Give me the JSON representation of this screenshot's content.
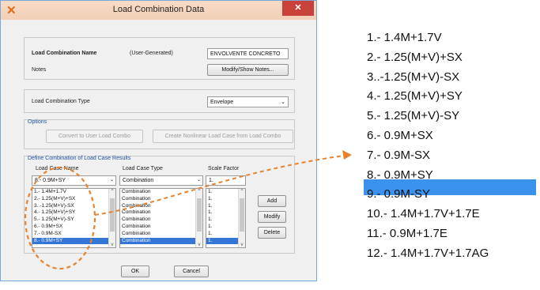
{
  "dialog": {
    "title": "Load Combination Data",
    "close_label": "✕",
    "combo_name_label": "Load Combination Name",
    "user_generated": "(User-Generated)",
    "combo_name_value": "ENVOLVENTE CONCRETO",
    "notes_label": "Notes",
    "modify_notes_button": "Modify/Show Notes...",
    "combo_type_label": "Load Combination Type",
    "combo_type_value": "Envelope",
    "options_label": "Options",
    "convert_button": "Convert to User Load Combo",
    "nonlinear_button": "Create Nonlinear Load Case from Load Combo",
    "define_label": "Define Combination of Load Case Results",
    "col_case_name": "Load Case Name",
    "col_case_type": "Load Case Type",
    "col_scale_factor": "Scale Factor",
    "case_name_input": "8.- 0.9M+SY",
    "case_type_input": "Combination",
    "scale_factor_input": "1.",
    "case_names": [
      "1.- 1.4M+1.7V",
      "2.- 1.25(M+V)+SX",
      "3..-1.25(M+V)-SX",
      "4.- 1.25(M+V)+SY",
      "5.- 1.25(M+V)-SY",
      "6.- 0.9M+SX",
      "7.- 0.9M-SX",
      "8.- 0.9M+SY"
    ],
    "case_types": [
      "Combination",
      "Combination",
      "Combination",
      "Combination",
      "Combination",
      "Combination",
      "Combination",
      "Combination"
    ],
    "scale_factors": [
      "1.",
      "1.",
      "1.",
      "1.",
      "1.",
      "1.",
      "1.",
      "1."
    ],
    "selected_index": 7,
    "add_button": "Add",
    "modify_button": "Modify",
    "delete_button": "Delete",
    "ok_button": "OK",
    "cancel_button": "Cancel"
  },
  "combinations_list": [
    "1.- 1.4M+1.7V",
    "2.- 1.25(M+V)+SX",
    "3..-1.25(M+V)-SX",
    "4.- 1.25(M+V)+SY",
    "5.- 1.25(M+V)-SY",
    "6.- 0.9M+SX",
    "7.- 0.9M-SX",
    "8.- 0.9M+SY",
    "9.- 0.9M-SY",
    "10.- 1.4M+1.7V+1.7E",
    "11.- 0.9M+1.7E",
    "12.- 1.4M+1.7V+1.7AG"
  ],
  "colors": {
    "accent": "#3a92ec",
    "annotation": "#e8822e",
    "title_bar": "#f2cfb6"
  }
}
